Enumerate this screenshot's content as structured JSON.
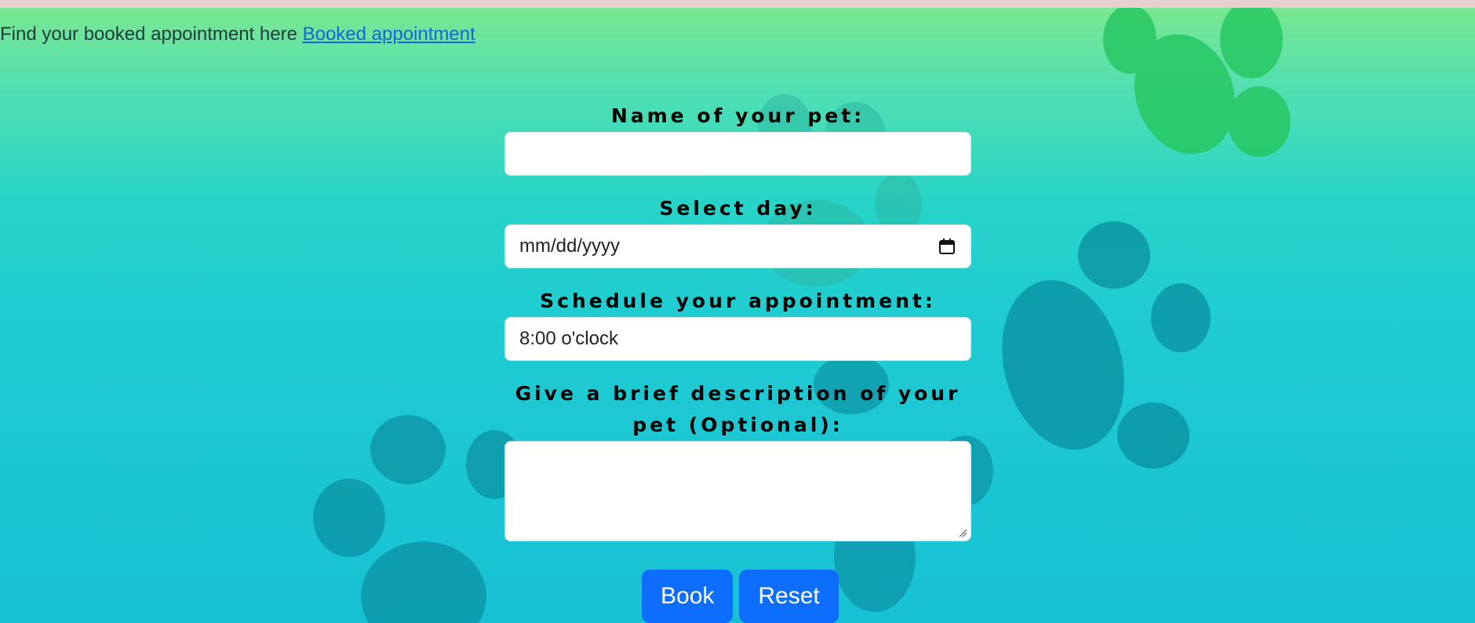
{
  "header": {
    "intro_text": "Find your booked appointment here ",
    "booked_link": "Booked appointment"
  },
  "form": {
    "pet_name_label": "Name of your pet:",
    "pet_name_value": "",
    "day_label": "Select day:",
    "day_placeholder": "mm/dd/yyyy",
    "schedule_label": "Schedule your appointment:",
    "schedule_value": "8:00 o'clock",
    "description_label": "Give a brief description of your pet (Optional):",
    "description_value": ""
  },
  "buttons": {
    "book": "Book",
    "reset": "Reset"
  },
  "colors": {
    "button": "#0d6efd",
    "link": "#1565d8",
    "paw_green": "#25c764",
    "paw_teal": "#0a8fa0"
  },
  "icons": [
    "calendar-icon",
    "resize-grip-icon",
    "paw-print-icon"
  ]
}
